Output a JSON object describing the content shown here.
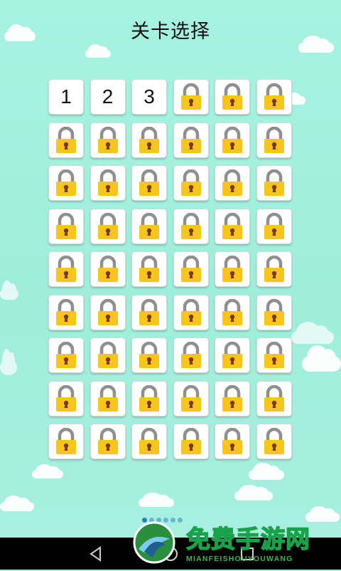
{
  "header": {
    "title": "关卡选择"
  },
  "levels": [
    {
      "label": "1",
      "locked": false
    },
    {
      "label": "2",
      "locked": false
    },
    {
      "label": "3",
      "locked": false
    }
  ],
  "locked_level_count": 51,
  "level_icon": "padlock-icon",
  "pager": {
    "pages": 6,
    "current_page": 1
  },
  "watermark": {
    "title": "免费手游网",
    "subtitle": "MIANFEISHOUYOUWANG"
  },
  "navbar": {
    "buttons": [
      "back-icon",
      "home-icon",
      "recents-icon"
    ]
  },
  "colors": {
    "background": "#9ef0dc",
    "lock_body": "#f7c51e",
    "lock_shackle": "#8f8f8f",
    "keyhole": "#7a3a0a",
    "watermark_green": "#1aa24a"
  }
}
